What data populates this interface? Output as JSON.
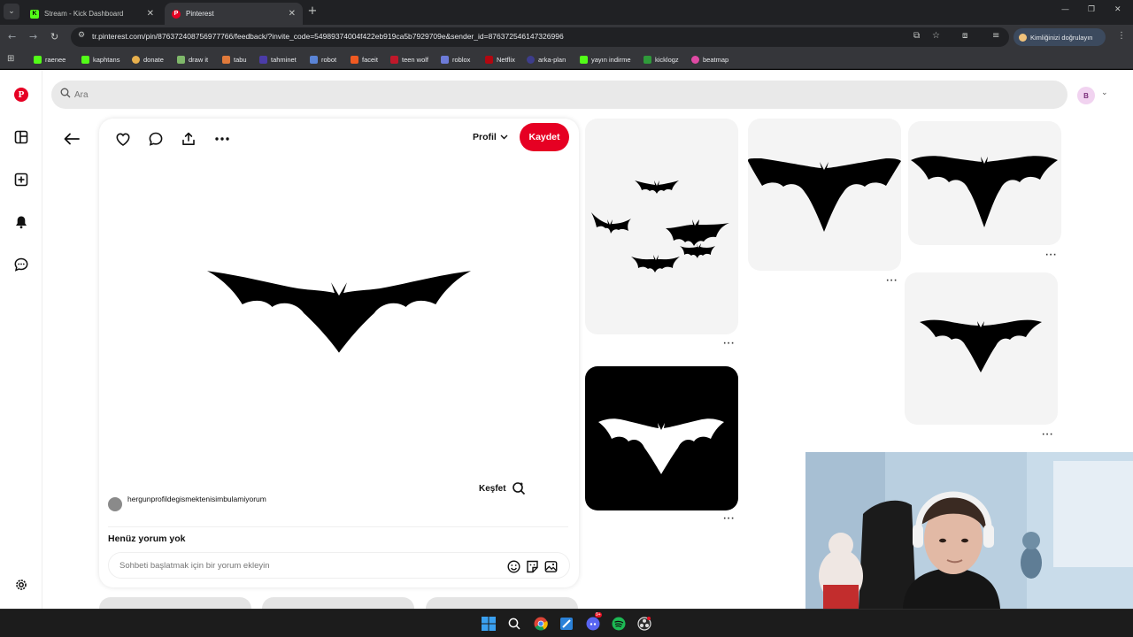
{
  "browser": {
    "tabs": [
      {
        "title": "Stream - Kick Dashboard",
        "active": false,
        "favicon_color": "#53fc18"
      },
      {
        "title": "Pinterest",
        "active": true,
        "favicon_color": "#e60023"
      }
    ],
    "url": "tr.pinterest.com/pin/876372408756977766/feedback/?invite_code=54989374004f422eb919ca5b7929709e&sender_id=876372546147326996",
    "verify_label": "Kimliğinizi doğrulayın",
    "bookmarks": [
      "raenee",
      "kaphtans",
      "donate",
      "draw it",
      "tabu",
      "tahminet",
      "robot",
      "faceit",
      "teen wolf",
      "roblox",
      "Netflix",
      "arka-plan",
      "yayın indirme",
      "kicklogz",
      "beatmap"
    ]
  },
  "search": {
    "placeholder": "Ara",
    "value": ""
  },
  "account": {
    "avatar_letter": "B",
    "avatar_color": "#f1d3f0"
  },
  "left_nav": {
    "icons": [
      "pinterest-logo",
      "boards-icon",
      "create-icon",
      "notifications-icon",
      "messages-icon",
      "settings-icon"
    ]
  },
  "pin": {
    "profile_dropdown": "Profil",
    "save_label": "Kaydet",
    "explore_label": "Keşfet",
    "owner_name": "hergunprofildegismektenisimbulamiyorum",
    "comments_title": "Henüz yorum yok",
    "comment_placeholder": "Sohbeti başlatmak için bir yorum ekleyin",
    "image": "black-bat-silhouette"
  },
  "related_pins": [
    {
      "image": "five-bats-group",
      "background": "#f4f4f4"
    },
    {
      "image": "black-bat",
      "background": "#f4f4f4"
    },
    {
      "image": "black-bat",
      "background": "#f4f4f4"
    },
    {
      "image": "white-bat-on-black",
      "background": "#000000"
    },
    {
      "image": "black-bat-small",
      "background": "#f4f4f4"
    }
  ],
  "colors": {
    "brand": "#e60023",
    "page_bg": "#ffffff",
    "browser_bg": "#35363a"
  },
  "taskbar_apps": [
    "windows-start",
    "search",
    "chrome",
    "paint",
    "discord",
    "spotify",
    "obs"
  ],
  "taskbar_badges": {
    "discord": "9+"
  }
}
